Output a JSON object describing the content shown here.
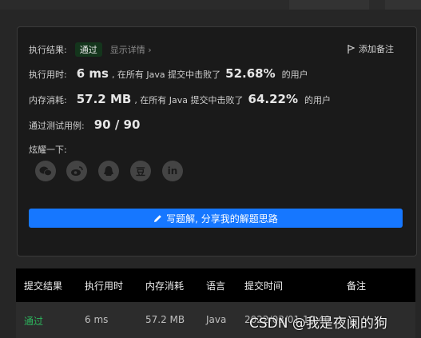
{
  "result": {
    "label": "执行结果:",
    "status": "通过",
    "detail_link": "显示详情 ›",
    "add_note": "添加备注"
  },
  "runtime": {
    "label": "执行用时:",
    "value": "6 ms",
    "mid_text": ", 在所有 Java 提交中击败了",
    "percent": "52.68%",
    "suffix": "的用户"
  },
  "memory": {
    "label": "内存消耗:",
    "value": "57.2 MB",
    "mid_text": ", 在所有 Java 提交中击败了",
    "percent": "64.22%",
    "suffix": "的用户"
  },
  "testcases": {
    "label": "通过测试用例:",
    "value": "90 / 90"
  },
  "share": {
    "label": "炫耀一下:",
    "icons": [
      "wechat-icon",
      "weibo-icon",
      "qq-icon",
      "douban-icon",
      "linkedin-icon"
    ],
    "douban_glyph": "豆",
    "linkedin_glyph": "in",
    "write_solution": "写题解, 分享我的解题思路"
  },
  "table": {
    "headers": [
      "提交结果",
      "执行用时",
      "内存消耗",
      "语言",
      "提交时间",
      "备注"
    ],
    "row": {
      "result": "通过",
      "runtime": "6 ms",
      "memory": "57.2 MB",
      "language": "Java",
      "time": "2022/03/01 10:40"
    }
  },
  "watermark": "CSDN @我是夜阑的狗",
  "colors": {
    "accent": "#1677ff",
    "pass": "#2db55d",
    "card_bg": "#1a1a1a",
    "page_bg": "#262626"
  }
}
